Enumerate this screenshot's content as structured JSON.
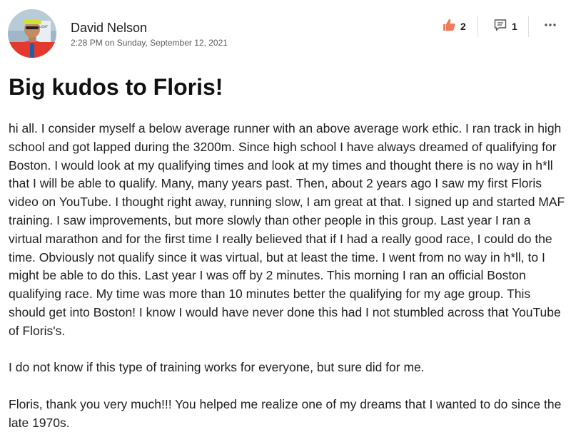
{
  "post": {
    "author": {
      "name": "David Nelson",
      "avatar_icon": "runner-avatar"
    },
    "timestamp": "2:28 PM on Sunday, September 12, 2021",
    "title": "Big kudos to Floris!",
    "paragraphs": [
      "hi all. I consider myself a below average runner with an above average work ethic. I ran track in high school and got lapped during the 3200m. Since high school I have always dreamed of qualifying for Boston. I would look at my qualifying times and look at my times and thought there is no way in h*ll that I will be able to qualify. Many, many years past. Then, about 2 years ago I saw my first Floris video on YouTube. I thought right away, running slow, I am great at that. I signed up and started MAF training. I saw improvements, but more slowly than other people in this group. Last year I ran a virtual marathon and for the first time I really believed that if I had a really good race, I could do the time. Obviously not qualify since it was virtual, but at least the time. I went from no way in h*ll, to I might be able to do this. Last year I was off by 2 minutes. This morning I ran an official Boston qualifying race. My time was more than 10 minutes better the qualifying for my age group. This should get into Boston! I know I would have never done this had I not stumbled across that YouTube of Floris's.",
      "I do not know if this type of training works for everyone, but sure did for me.",
      "Floris, thank you very much!!! You helped me realize one of my dreams that I wanted to do since the late 1970s."
    ]
  },
  "actions": {
    "likes": {
      "count": "2",
      "icon": "thumbs-up-icon",
      "color": "#f07a5c"
    },
    "comments": {
      "count": "1",
      "icon": "comment-icon"
    },
    "more": {
      "icon": "more-icon"
    }
  }
}
